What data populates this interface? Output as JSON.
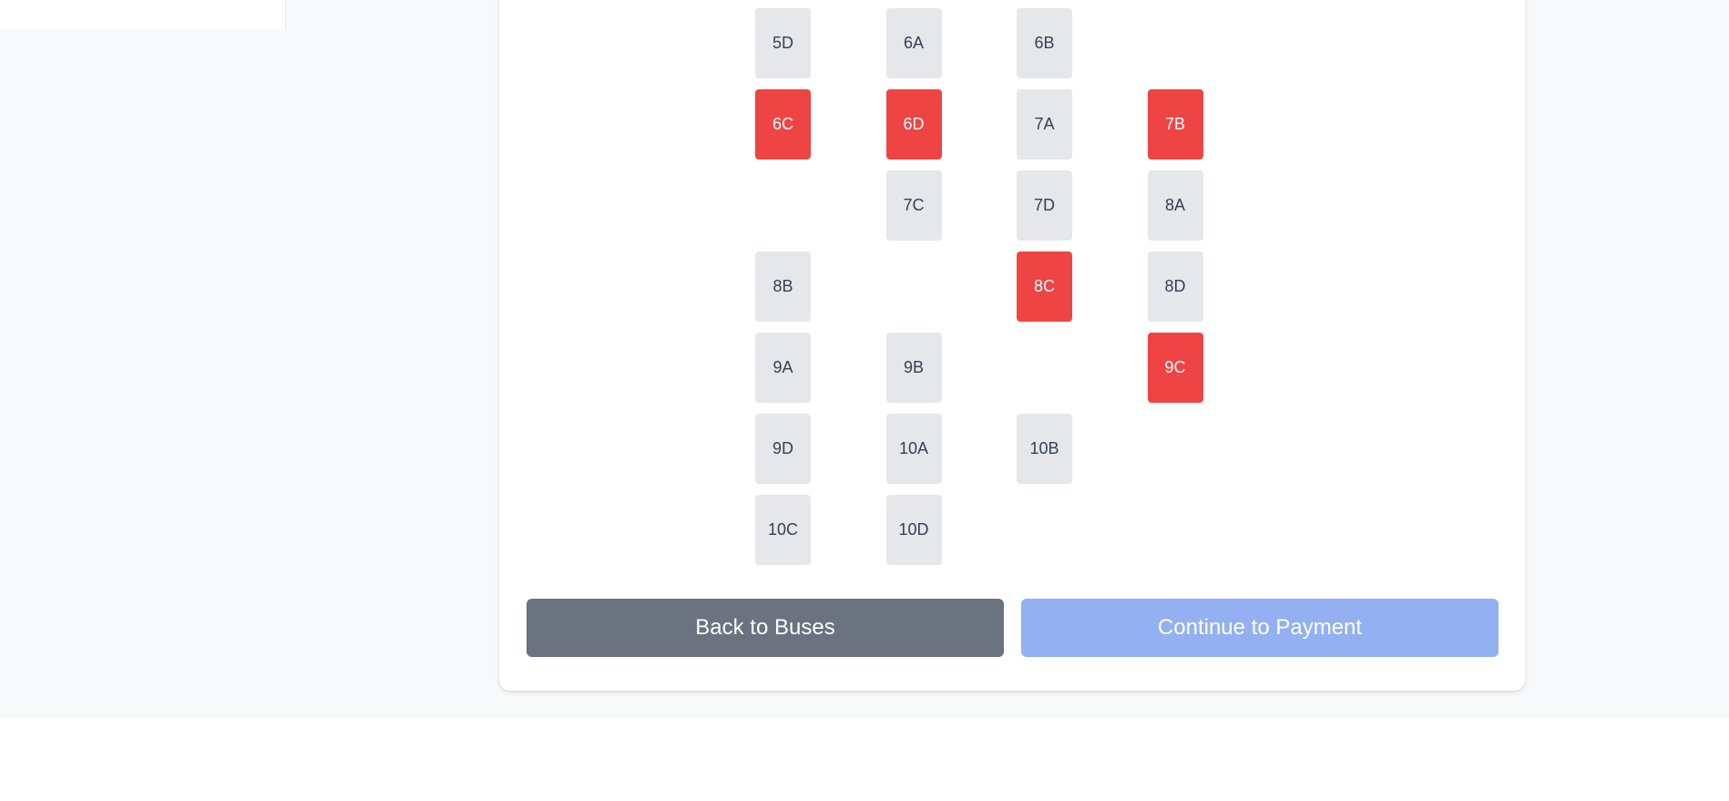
{
  "colors": {
    "available_seat": "#e5e7eb",
    "booked_seat": "#ef4444",
    "back_button": "#6b7280",
    "continue_button_disabled": "#93b0f2"
  },
  "seat_map": {
    "rows": [
      [
        {
          "label": "5D",
          "status": "available"
        },
        {
          "label": "6A",
          "status": "available"
        },
        {
          "label": "6B",
          "status": "available"
        },
        {
          "label": "",
          "status": "empty"
        }
      ],
      [
        {
          "label": "6C",
          "status": "booked"
        },
        {
          "label": "6D",
          "status": "booked"
        },
        {
          "label": "7A",
          "status": "available"
        },
        {
          "label": "7B",
          "status": "booked"
        }
      ],
      [
        {
          "label": "",
          "status": "empty"
        },
        {
          "label": "7C",
          "status": "available"
        },
        {
          "label": "7D",
          "status": "available"
        },
        {
          "label": "8A",
          "status": "available"
        }
      ],
      [
        {
          "label": "8B",
          "status": "available"
        },
        {
          "label": "",
          "status": "empty"
        },
        {
          "label": "8C",
          "status": "booked"
        },
        {
          "label": "8D",
          "status": "available"
        }
      ],
      [
        {
          "label": "9A",
          "status": "available"
        },
        {
          "label": "9B",
          "status": "available"
        },
        {
          "label": "",
          "status": "empty"
        },
        {
          "label": "9C",
          "status": "booked"
        }
      ],
      [
        {
          "label": "9D",
          "status": "available"
        },
        {
          "label": "10A",
          "status": "available"
        },
        {
          "label": "10B",
          "status": "available"
        },
        {
          "label": "",
          "status": "empty"
        }
      ],
      [
        {
          "label": "10C",
          "status": "available"
        },
        {
          "label": "10D",
          "status": "available"
        },
        {
          "label": "",
          "status": "empty"
        },
        {
          "label": "",
          "status": "empty"
        }
      ]
    ]
  },
  "actions": {
    "back_label": "Back to Buses",
    "continue_label": "Continue to Payment"
  }
}
